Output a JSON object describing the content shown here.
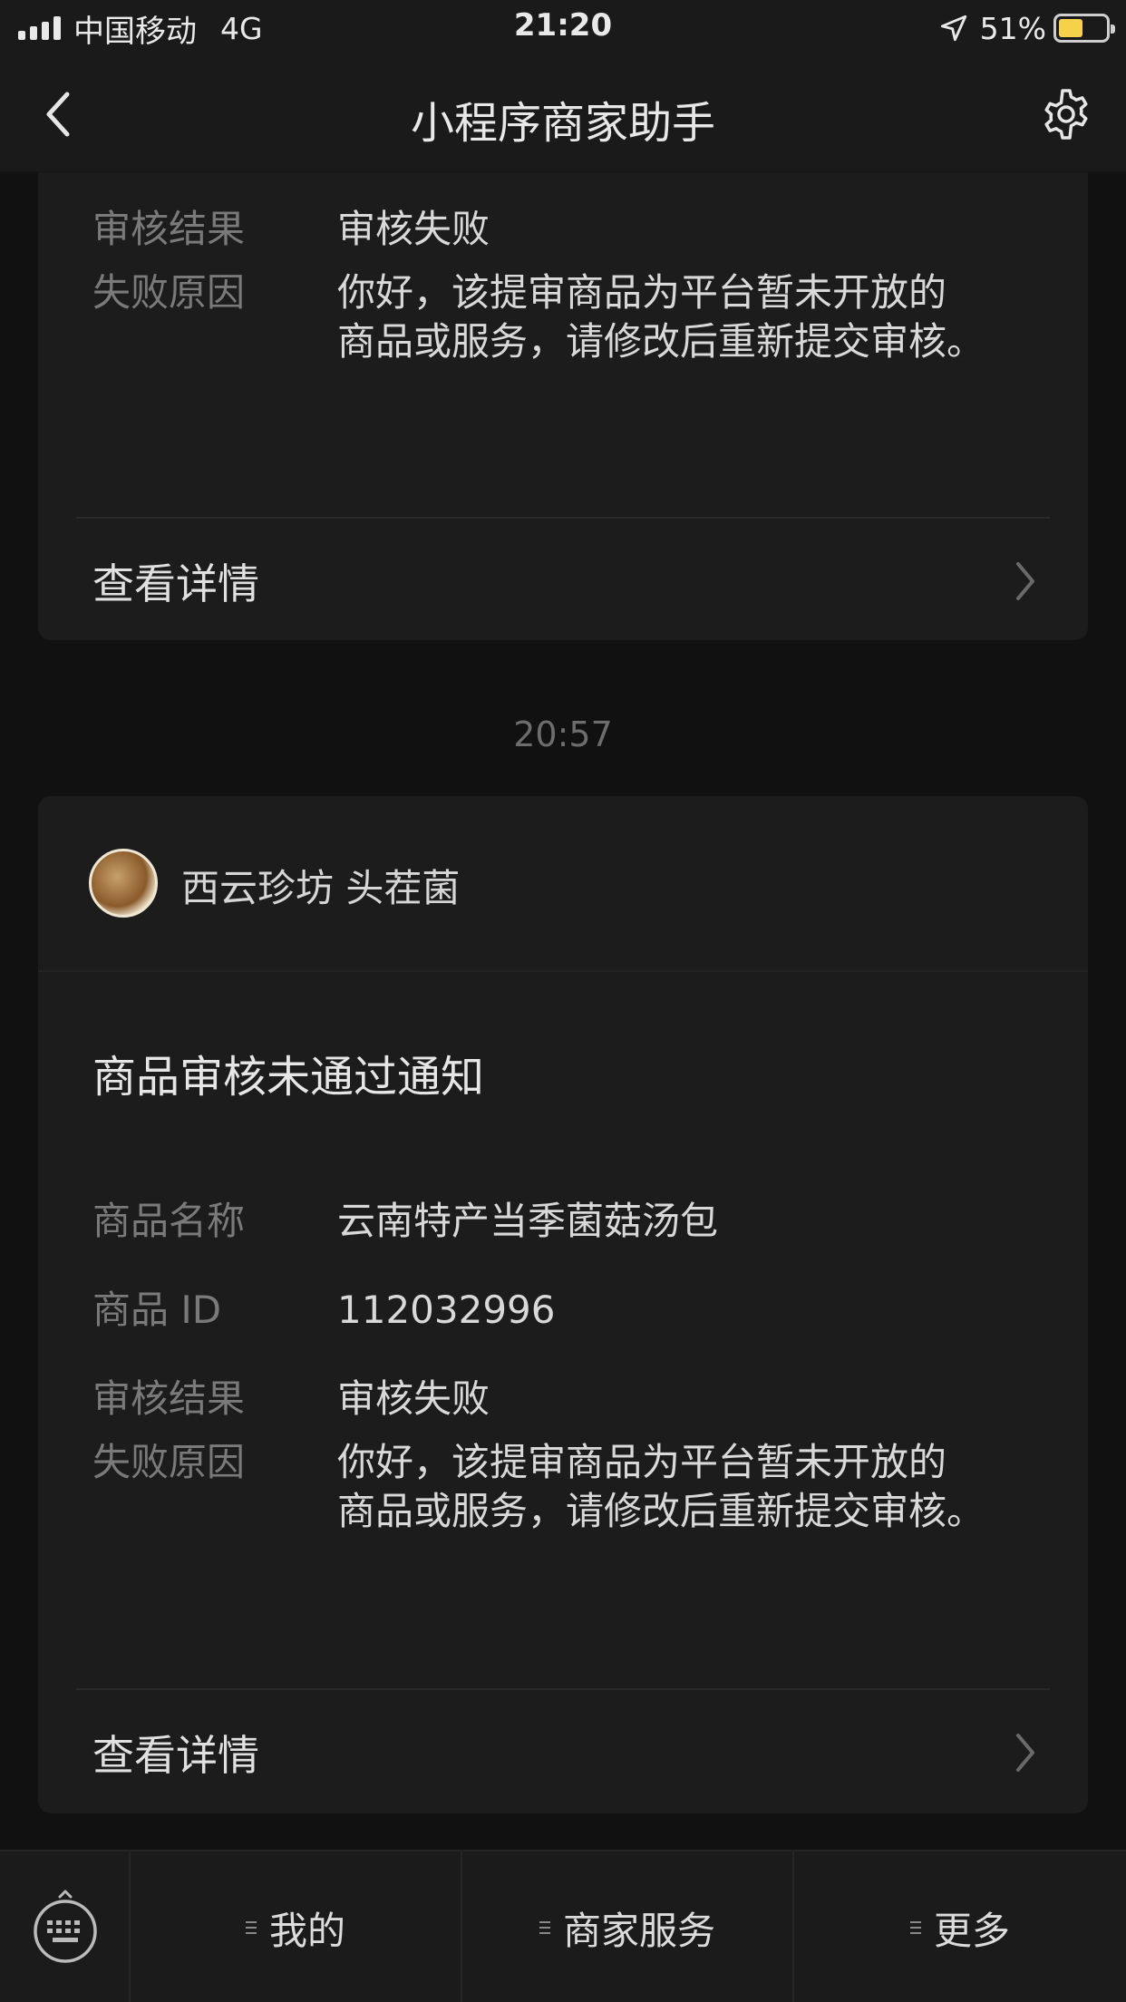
{
  "status_bar": {
    "carrier": "中国移动",
    "network": "4G",
    "time": "21:20",
    "battery_percent": "51%",
    "battery_level": 0.51,
    "signal_bars": 4
  },
  "nav": {
    "title": "小程序商家助手",
    "back_icon": "chevron-left-icon",
    "settings_icon": "gear-icon"
  },
  "messages": [
    {
      "fields": [
        {
          "label": "审核结果",
          "value": "审核失败"
        },
        {
          "label": "失败原因",
          "value": "你好，该提审商品为平台暂未开放的\n商品或服务，请修改后重新提交审核。"
        }
      ],
      "detail_link": "查看详情"
    },
    {
      "timestamp": "20:57",
      "sender": "西云珍坊 头茬菌",
      "title": "商品审核未通过通知",
      "fields": [
        {
          "label": "商品名称",
          "value": "云南特产当季菌菇汤包"
        },
        {
          "label": "商品 ID",
          "value": "112032996"
        },
        {
          "label": "审核结果",
          "value": "审核失败"
        },
        {
          "label": "失败原因",
          "value": "你好，该提审商品为平台暂未开放的\n商品或服务，请修改后重新提交审核。"
        }
      ],
      "detail_link": "查看详情"
    }
  ],
  "toolbar": {
    "keyboard_icon": "keyboard-icon",
    "items": [
      {
        "label": "我的"
      },
      {
        "label": "商家服务"
      },
      {
        "label": "更多"
      }
    ]
  },
  "colors": {
    "background": "#111111",
    "card": "#1c1c1c",
    "label_text": "#7a7a7a",
    "value_text": "#d9d9d9",
    "battery_fill": "#f6d24a"
  }
}
